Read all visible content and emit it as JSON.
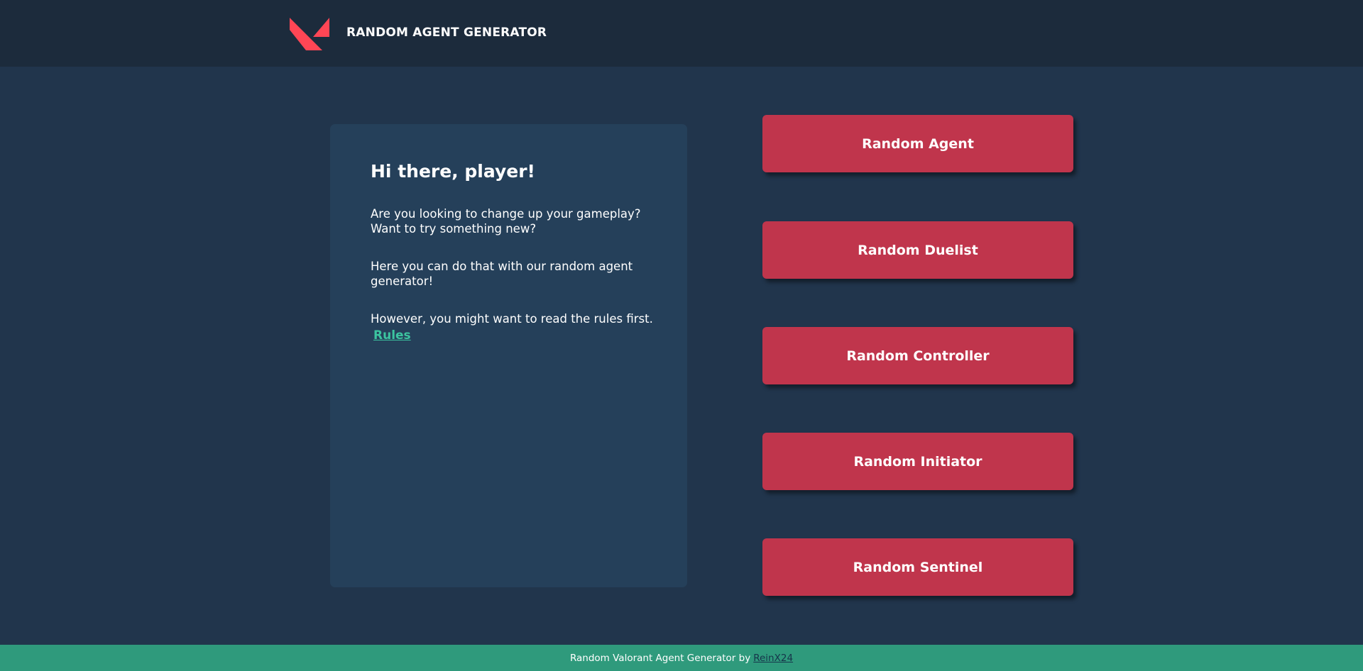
{
  "header": {
    "title": "RANDOM AGENT GENERATOR",
    "logo_icon": "valorant-logo-icon",
    "logo_color": "#ff4655"
  },
  "intro": {
    "heading": "Hi there, player!",
    "paragraph_1": "Are you looking to change up your gameplay? Want to try something new?",
    "paragraph_2": "Here you can do that with our random agent generator!",
    "paragraph_3": "However, you might want to read the rules first.",
    "rules_link": "Rules",
    "link_color": "#3cc4a0"
  },
  "buttons": {
    "agent": "Random Agent",
    "duelist": "Random Duelist",
    "controller": "Random Controller",
    "initiator": "Random Initiator",
    "sentinel": "Random Sentinel",
    "color": "#c0354c"
  },
  "footer": {
    "text": "Random Valorant Agent Generator by",
    "author_link": "ReinX24",
    "color": "#2f9a7c"
  }
}
